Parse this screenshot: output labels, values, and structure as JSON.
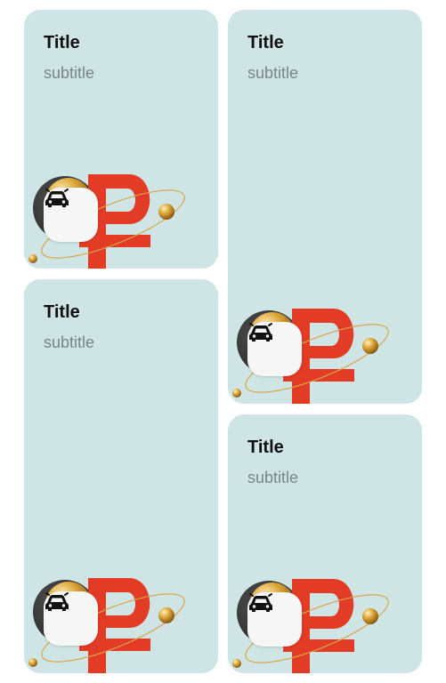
{
  "cards": [
    {
      "title": "Title",
      "subtitle": "subtitle",
      "icon": "car-icon"
    },
    {
      "title": "Title",
      "subtitle": "subtitle",
      "icon": "car-icon"
    },
    {
      "title": "Title",
      "subtitle": "subtitle",
      "icon": "car-icon"
    },
    {
      "title": "Title",
      "subtitle": "subtitle",
      "icon": "car-icon"
    }
  ],
  "colors": {
    "card_bg": "#cfe5e5",
    "ruble_red": "#e23b26",
    "gold": "#e0a93c",
    "dark_disc": "#2c2c2c",
    "badge_bg": "#f6f6f6"
  }
}
